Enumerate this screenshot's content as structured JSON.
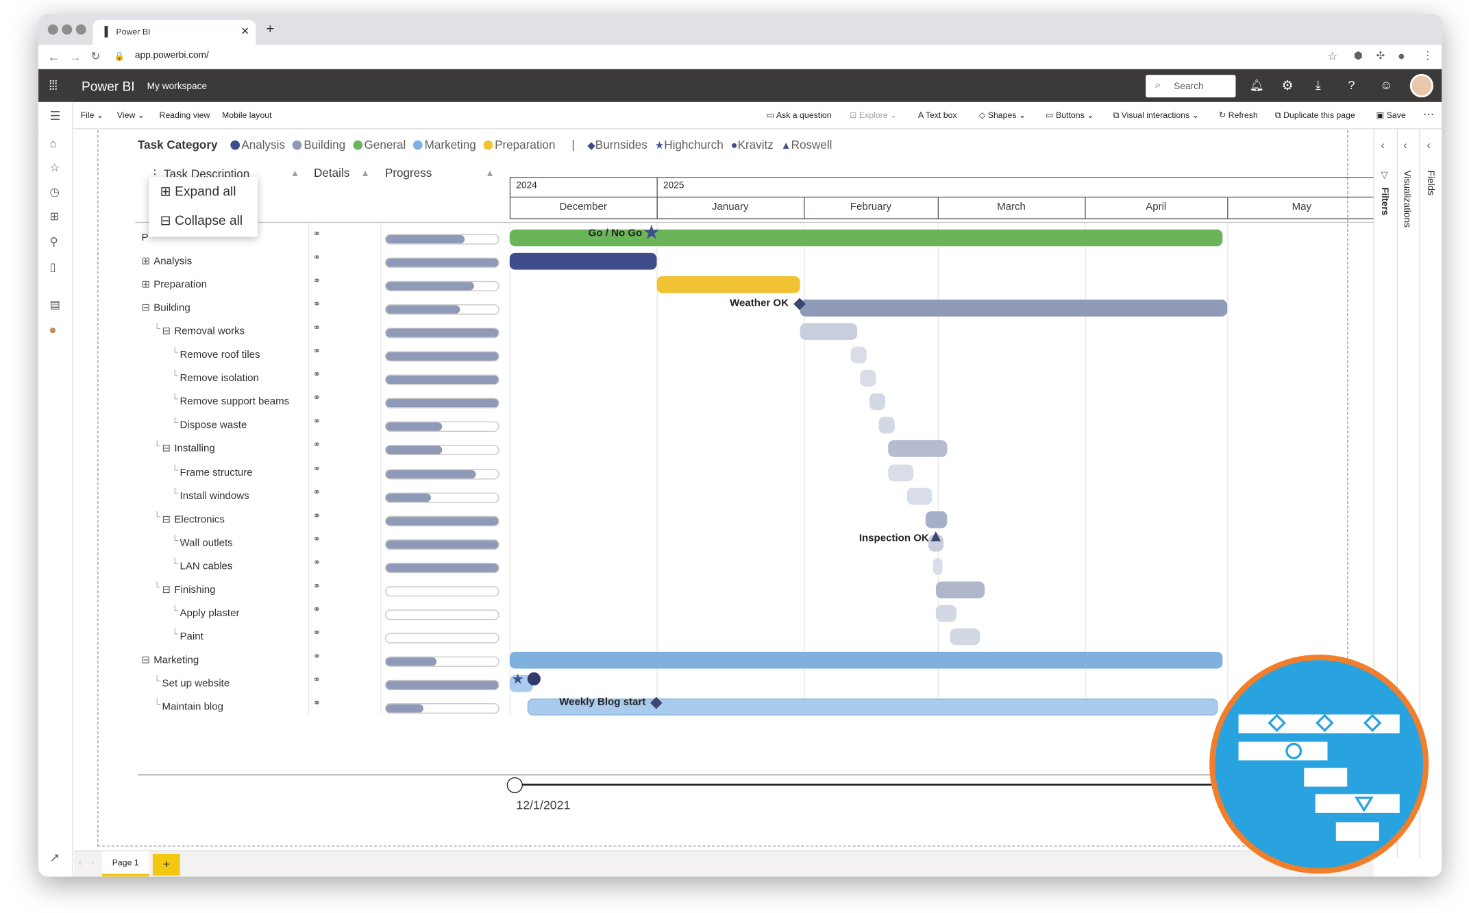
{
  "browser": {
    "tab_title": "Power BI",
    "url": "app.powerbi.com/"
  },
  "app": {
    "name": "Power BI",
    "workspace": "My workspace",
    "search_placeholder": "Search"
  },
  "ribbon": {
    "left": [
      "File",
      "View",
      "Reading view",
      "Mobile layout"
    ],
    "ask": "Ask a question",
    "explore": "Explore",
    "textbox": "Text box",
    "shapes": "Shapes",
    "buttons": "Buttons",
    "visual_interactions": "Visual interactions",
    "refresh": "Refresh",
    "duplicate": "Duplicate this page",
    "save": "Save"
  },
  "legend": {
    "title": "Task Category",
    "categories": [
      {
        "name": "Analysis",
        "color": "#3f4d8a"
      },
      {
        "name": "Building",
        "color": "#8f9ab8"
      },
      {
        "name": "General",
        "color": "#6ab55a"
      },
      {
        "name": "Marketing",
        "color": "#7fb0e0"
      },
      {
        "name": "Preparation",
        "color": "#f1c232"
      }
    ],
    "separator": "|",
    "owners": [
      {
        "name": "Burnsides",
        "shape": "diamond"
      },
      {
        "name": "Highchurch",
        "shape": "star"
      },
      {
        "name": "Kravitz",
        "shape": "circle"
      },
      {
        "name": "Roswell",
        "shape": "triangle"
      }
    ]
  },
  "table_headers": {
    "task": "Task Description",
    "details": "Details",
    "progress": "Progress"
  },
  "context_menu": {
    "expand": "Expand all",
    "collapse": "Collapse all"
  },
  "timeline": {
    "years": [
      "2024",
      "2025"
    ],
    "months": [
      "December",
      "January",
      "February",
      "March",
      "April",
      "May"
    ]
  },
  "tasks": [
    {
      "label": "P",
      "indent": 0,
      "toggle": "",
      "progress": 0.7
    },
    {
      "label": "Analysis",
      "indent": 0,
      "toggle": "plus",
      "progress": 1.0
    },
    {
      "label": "Preparation",
      "indent": 0,
      "toggle": "plus",
      "progress": 0.78
    },
    {
      "label": "Building",
      "indent": 0,
      "toggle": "minus",
      "progress": 0.66
    },
    {
      "label": "Removal works",
      "indent": 1,
      "toggle": "minus",
      "progress": 1.0
    },
    {
      "label": "Remove roof tiles",
      "indent": 2,
      "toggle": "",
      "progress": 1.0
    },
    {
      "label": "Remove isolation",
      "indent": 2,
      "toggle": "",
      "progress": 1.0
    },
    {
      "label": "Remove support beams",
      "indent": 2,
      "toggle": "",
      "progress": 1.0
    },
    {
      "label": "Dispose waste",
      "indent": 2,
      "toggle": "",
      "progress": 0.5
    },
    {
      "label": "Installing",
      "indent": 1,
      "toggle": "minus",
      "progress": 0.5
    },
    {
      "label": "Frame structure",
      "indent": 2,
      "toggle": "",
      "progress": 0.8
    },
    {
      "label": "Install windows",
      "indent": 2,
      "toggle": "",
      "progress": 0.4
    },
    {
      "label": "Electronics",
      "indent": 1,
      "toggle": "minus",
      "progress": 1.0
    },
    {
      "label": "Wall outlets",
      "indent": 2,
      "toggle": "",
      "progress": 1.0
    },
    {
      "label": "LAN cables",
      "indent": 2,
      "toggle": "",
      "progress": 1.0
    },
    {
      "label": "Finishing",
      "indent": 1,
      "toggle": "minus",
      "progress": 0.0
    },
    {
      "label": "Apply plaster",
      "indent": 2,
      "toggle": "",
      "progress": 0.0
    },
    {
      "label": "Paint",
      "indent": 2,
      "toggle": "",
      "progress": 0.0
    },
    {
      "label": "Marketing",
      "indent": 0,
      "toggle": "minus",
      "progress": 0.45
    },
    {
      "label": "Set up website",
      "indent": 1,
      "toggle": "",
      "progress": 1.0
    },
    {
      "label": "Maintain blog",
      "indent": 1,
      "toggle": "",
      "progress": 0.33
    }
  ],
  "milestones": {
    "go_nogo": "Go / No Go",
    "weather": "Weather OK",
    "inspection": "Inspection OK",
    "blog": "Weekly Blog start"
  },
  "slider": {
    "date": "12/1/2021"
  },
  "pages": {
    "current": "Page 1",
    "add": "+"
  },
  "right_panes": [
    "Filters",
    "Visualizations",
    "Fields"
  ],
  "colors": {
    "general": "#6ab55a",
    "analysis": "#3f4d8a",
    "preparation": "#f1c232",
    "building": "#8f9ab8",
    "building_light": "#c9cedc",
    "marketing": "#7fb0e0",
    "marketing_light": "#a9cbee",
    "badge_blue": "#29a3e0",
    "badge_orange": "#f07e2b"
  }
}
